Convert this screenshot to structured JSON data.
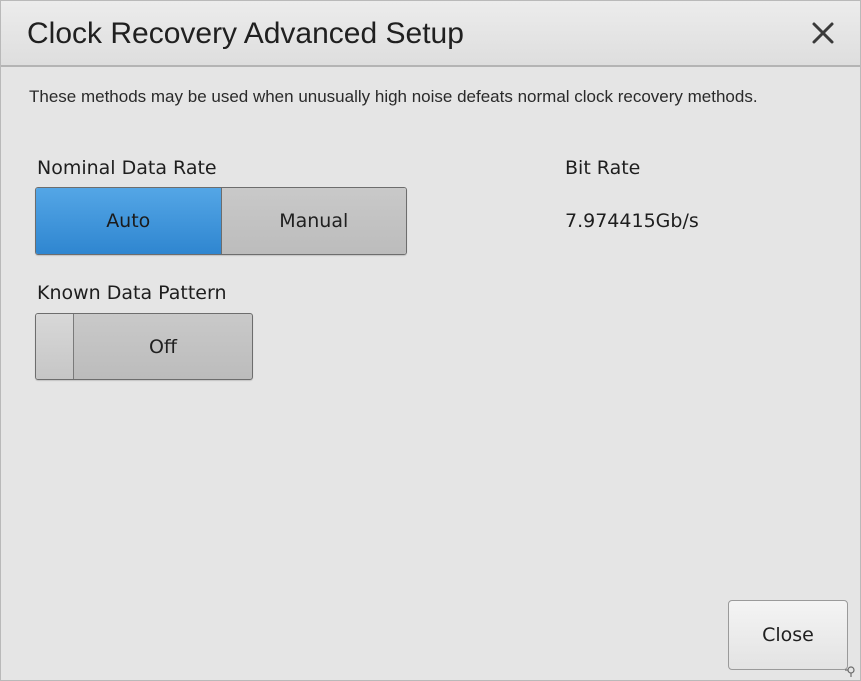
{
  "window": {
    "title": "Clock Recovery Advanced Setup"
  },
  "description": "These methods may be used when unusually high noise  defeats normal clock recovery methods.",
  "nominal_data_rate": {
    "label": "Nominal Data Rate",
    "options": [
      "Auto",
      "Manual"
    ],
    "selected": "Auto"
  },
  "bit_rate": {
    "label": "Bit Rate",
    "value": "7.974415Gb/s"
  },
  "known_data_pattern": {
    "label": "Known Data Pattern",
    "state": "Off"
  },
  "footer": {
    "close_label": "Close"
  },
  "colors": {
    "accent": "#3a92dc",
    "background": "#e5e5e5",
    "button_inactive": "#c3c3c3"
  },
  "icons": {
    "close": "close-x-icon",
    "resize": "resize-grip-icon"
  }
}
